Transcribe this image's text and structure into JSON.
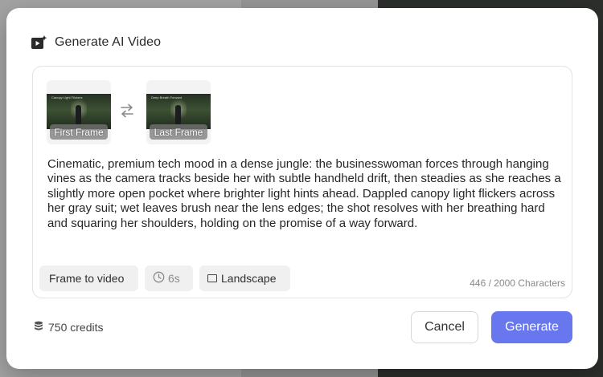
{
  "dialog": {
    "title": "Generate AI Video"
  },
  "frames": {
    "first": {
      "label": "First Frame",
      "caption": "Canopy Light Flickers"
    },
    "last": {
      "label": "Last Frame",
      "caption": "Deep Breath Forward"
    }
  },
  "prompt": {
    "text": "Cinematic, premium tech mood in a dense jungle: the businesswoman forces through hanging vines as the camera tracks beside her with subtle handheld drift, then steadies as she reaches a slightly more open pocket where brighter light hints ahead. Dappled canopy light flickers across her gray suit; wet leaves brush near the lens edges; the shot resolves with her breathing hard and squaring her shoulders, holding on the promise of a way forward.",
    "char_count": "446 / 2000 Characters"
  },
  "options": {
    "mode": "Frame to video",
    "duration": "6s",
    "orientation": "Landscape"
  },
  "footer": {
    "credits": "750 credits",
    "cancel": "Cancel",
    "generate": "Generate"
  },
  "colors": {
    "accent": "#6877ee",
    "panel_border": "#e3e3e3",
    "chip_bg": "#f0f0f0"
  },
  "icons": {
    "title": "video-sparkle-icon",
    "swap": "swap-arrows-icon",
    "clock": "clock-icon",
    "orientation": "landscape-rect-icon",
    "credits": "database-coins-icon"
  }
}
